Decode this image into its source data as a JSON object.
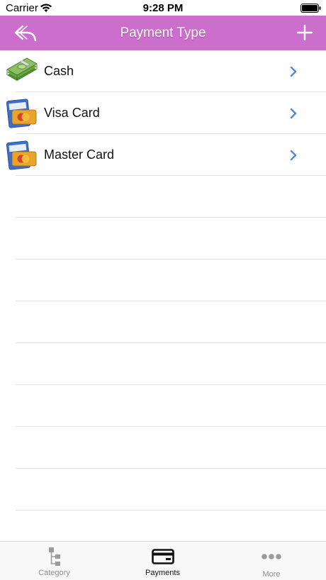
{
  "status_bar": {
    "carrier": "Carrier",
    "time": "9:28 PM"
  },
  "nav": {
    "title": "Payment Type",
    "back_icon": "reply-arrow-icon",
    "add_icon": "plus-icon"
  },
  "colors": {
    "nav_bg": "#cc6fcc",
    "chevron": "#5b84d6",
    "tab_active": "#111111",
    "tab_inactive": "#8e8e93"
  },
  "payment_types": [
    {
      "label": "Cash",
      "icon": "cash-icon"
    },
    {
      "label": "Visa Card",
      "icon": "credit-card-icon"
    },
    {
      "label": "Master Card",
      "icon": "credit-card-icon"
    }
  ],
  "tab_bar": {
    "tabs": [
      {
        "label": "Category",
        "icon": "category-tree-icon",
        "active": false
      },
      {
        "label": "Payments",
        "icon": "payment-card-icon",
        "active": true
      },
      {
        "label": "More",
        "icon": "more-dots-icon",
        "active": false
      }
    ]
  }
}
